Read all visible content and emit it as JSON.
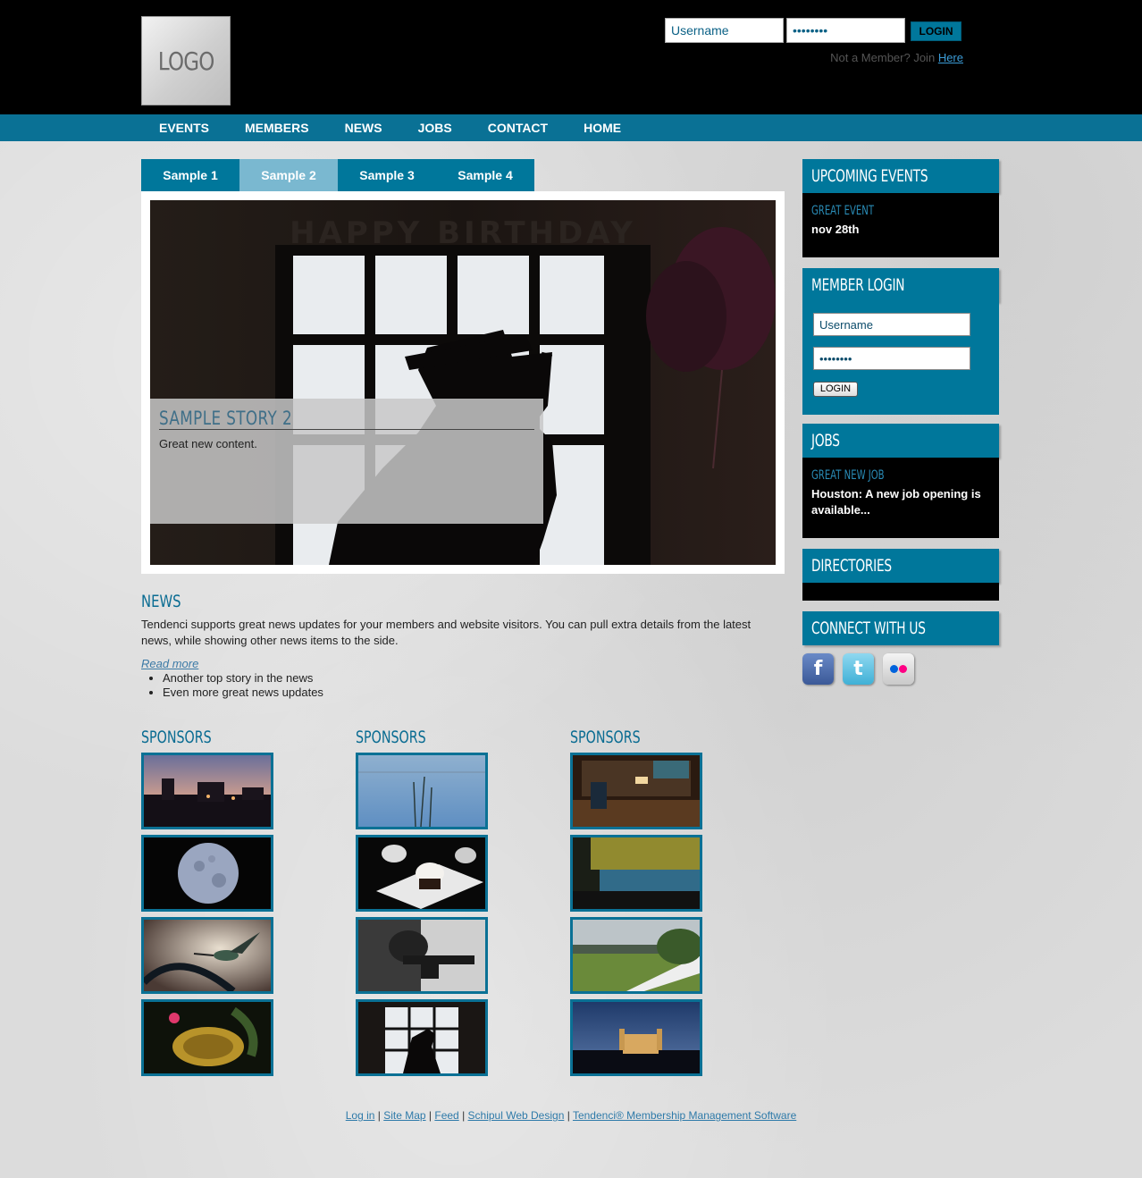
{
  "header": {
    "logo_text": "LOGO",
    "username_placeholder": "Username",
    "username_value": "Username",
    "password_value": "••••••••",
    "login_label": "LOGIN",
    "not_member_text": "Not a Member? Join",
    "join_link": "Here"
  },
  "nav": {
    "items": [
      "EVENTS",
      "MEMBERS",
      "NEWS",
      "JOBS",
      "CONTACT",
      "HOME"
    ]
  },
  "tabs": {
    "items": [
      "Sample 1",
      "Sample 2",
      "Sample 3",
      "Sample 4"
    ],
    "active_index": 1
  },
  "slide": {
    "banner_text": "HAPPY BIRTHDAY",
    "caption_title": "SAMPLE STORY 2",
    "caption_text": "Great new content."
  },
  "news": {
    "title": "NEWS",
    "body": "Tendenci supports great news updates for your members and website visitors. You can pull extra details from the latest news, while showing other news items to the side.",
    "read_more": "Read more",
    "items": [
      "Another top story in the news",
      "Even more great news updates"
    ]
  },
  "sponsors": {
    "titles": [
      "SPONSORS",
      "SPONSORS",
      "SPONSORS"
    ]
  },
  "sidebar": {
    "events": {
      "title": "UPCOMING EVENTS",
      "event_name": "GREAT EVENT",
      "event_date": "nov 28th"
    },
    "member_login": {
      "title": "MEMBER LOGIN",
      "username_value": "Username",
      "password_value": "••••••••",
      "login_label": "LOGIN"
    },
    "jobs": {
      "title": "JOBS",
      "job_name": "GREAT NEW JOB",
      "job_text": "Houston: A new job opening is available..."
    },
    "directories": {
      "title": "DIRECTORIES"
    },
    "connect": {
      "title": "CONNECT WITH US",
      "icons": [
        "facebook-icon",
        "twitter-icon",
        "flickr-icon"
      ],
      "facebook_glyph": "f",
      "twitter_glyph": "t"
    }
  },
  "footer": {
    "links": [
      "Log in",
      "Site Map",
      "Feed",
      "Schipul Web Design",
      "Tendenci® Membership Management Software"
    ],
    "separator": " | "
  },
  "colors": {
    "accent": "#00779b",
    "nav": "#0a7195",
    "tab_active": "#7ab8d0",
    "header_bg": "#000000",
    "title_blue": "#0a6c92"
  }
}
